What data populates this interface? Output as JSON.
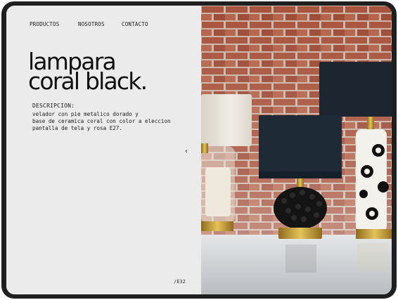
{
  "nav": {
    "items": [
      "PRODUCTOS",
      "NOSOTROS",
      "CONTACTO"
    ]
  },
  "product": {
    "title_line1": "lampara",
    "title_line2": "coral black.",
    "description_label": "DESCRIPCION:",
    "description_lines": [
      "velador con pie metalico dorado y",
      "base de ceramica coral con color a eleccion",
      "pantalla de tela y rosa E27."
    ],
    "code": "/E32"
  },
  "colors": {
    "background": "#ebebeb",
    "text": "#111111",
    "frame": "#1f1f1f",
    "brick": "#a65440",
    "lamp_shade_dark": "#1e2a35",
    "lamp_shade_light": "#e8e3da",
    "brass": "#c9a23c"
  },
  "icons": {
    "prev": "chevron-left-icon"
  }
}
